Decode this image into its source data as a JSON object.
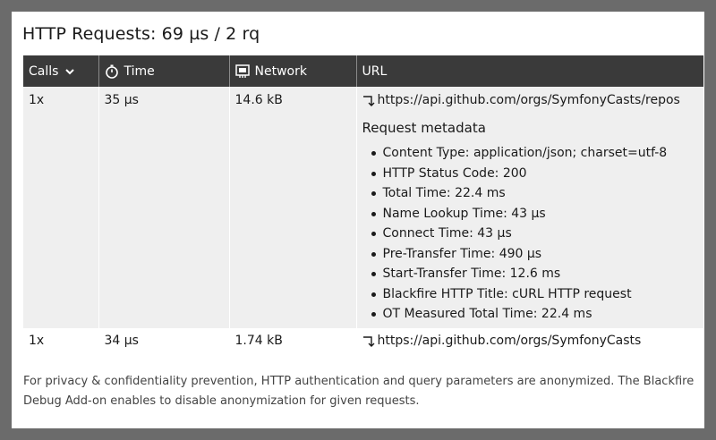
{
  "title": "HTTP Requests: 69 µs / 2 rq",
  "columns": {
    "calls": "Calls",
    "time": "Time",
    "network": "Network",
    "url": "URL"
  },
  "rows": [
    {
      "calls": "1x",
      "time": "35 µs",
      "network": "14.6 kB",
      "url": "https://api.github.com/orgs/SymfonyCasts/repos",
      "metadata_title": "Request metadata",
      "metadata": [
        "Content Type: application/json; charset=utf-8",
        "HTTP Status Code: 200",
        "Total Time: 22.4 ms",
        "Name Lookup Time: 43 µs",
        "Connect Time: 43 µs",
        "Pre-Transfer Time: 490 µs",
        "Start-Transfer Time: 12.6 ms",
        "Blackfire HTTP Title: cURL HTTP request",
        "OT Measured Total Time: 22.4 ms"
      ]
    },
    {
      "calls": "1x",
      "time": "34 µs",
      "network": "1.74 kB",
      "url": "https://api.github.com/orgs/SymfonyCasts"
    }
  ],
  "footnote": "For privacy & confidentiality prevention, HTTP authentication and query parameters are anonymized. The Blackfire Debug Add-on enables to disable anonymization for given requests.",
  "icons": {
    "calls_sort": "chevron-down-icon",
    "time": "stopwatch-icon",
    "network": "network-icon",
    "url_row": "corner-arrow-icon"
  },
  "colors": {
    "header_bg": "#3a3a3a",
    "expanded_row_bg": "#efefef",
    "page_bg": "#6b6b6b"
  }
}
